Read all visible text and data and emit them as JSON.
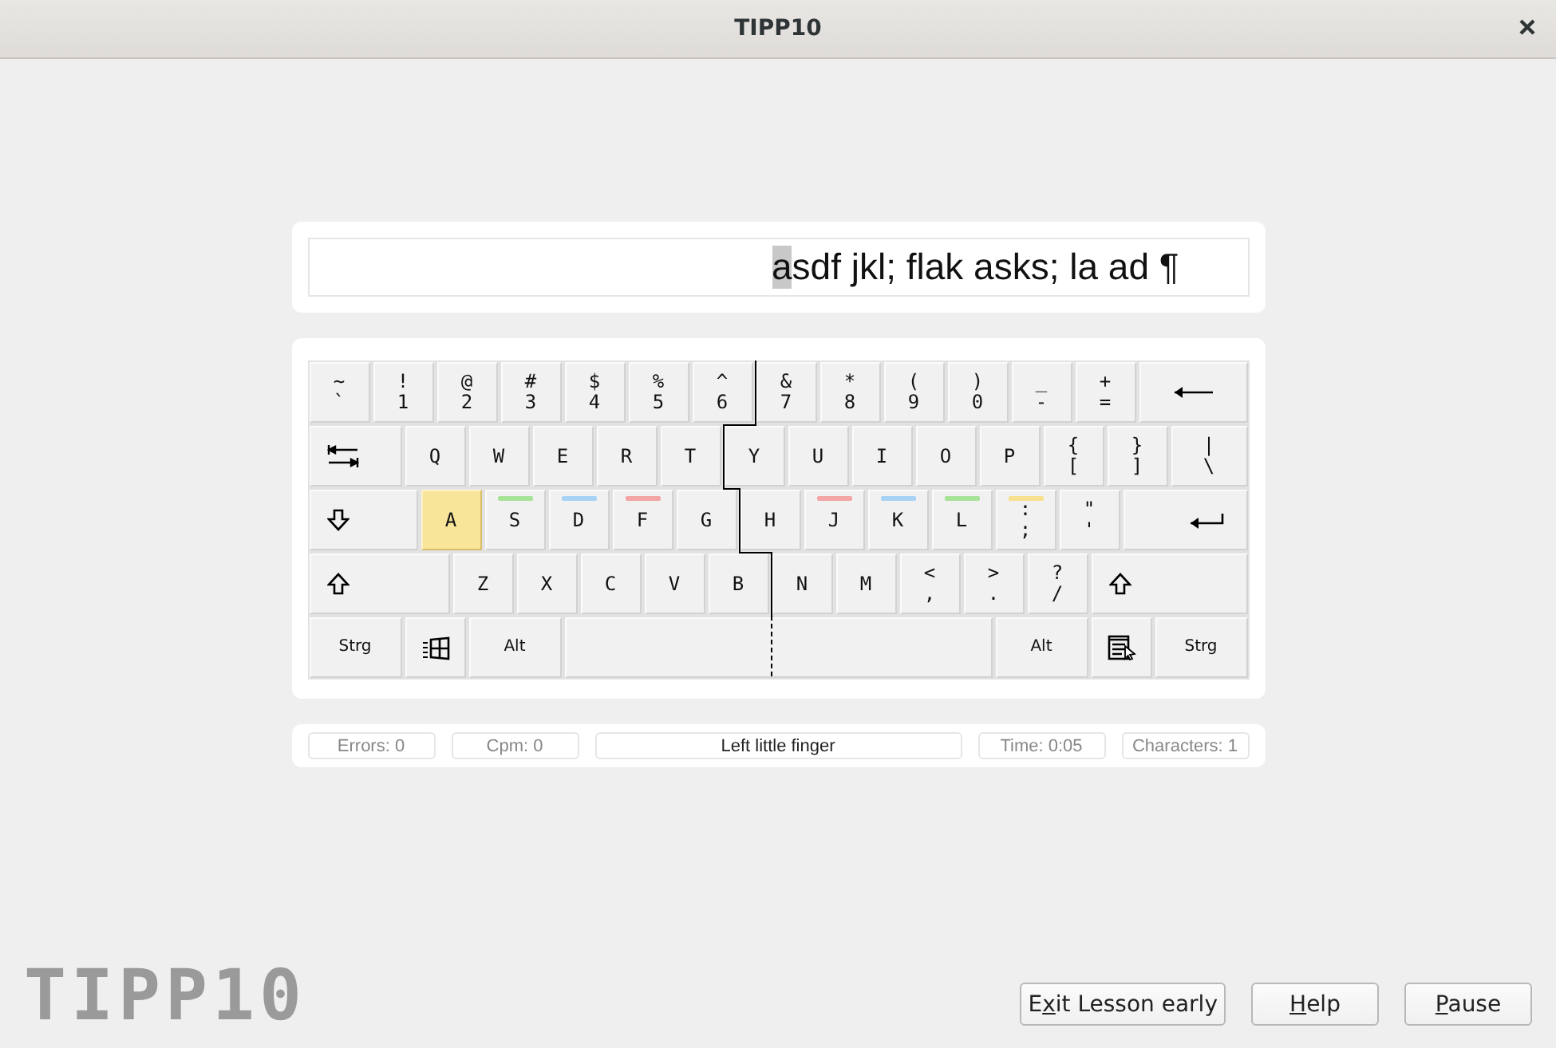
{
  "window": {
    "title": "TIPP10"
  },
  "text_line": {
    "current": "a",
    "remaining": "sdf jkl; flak asks; la ad ¶"
  },
  "keyboard": {
    "rows": [
      {
        "keys": [
          {
            "kind": "dual",
            "shift": "~",
            "label": "`",
            "highlighted": false
          },
          {
            "kind": "dual",
            "shift": "!",
            "label": "1",
            "highlighted": false
          },
          {
            "kind": "dual",
            "shift": "@",
            "label": "2",
            "highlighted": false
          },
          {
            "kind": "dual",
            "shift": "#",
            "label": "3",
            "highlighted": false
          },
          {
            "kind": "dual",
            "shift": "$",
            "label": "4",
            "highlighted": false
          },
          {
            "kind": "dual",
            "shift": "%",
            "label": "5",
            "highlighted": false
          },
          {
            "kind": "dual",
            "shift": "^",
            "label": "6",
            "highlighted": false
          },
          {
            "kind": "dual",
            "shift": "&",
            "label": "7",
            "highlighted": false
          },
          {
            "kind": "dual",
            "shift": "*",
            "label": "8",
            "highlighted": false
          },
          {
            "kind": "dual",
            "shift": "(",
            "label": "9",
            "highlighted": false
          },
          {
            "kind": "dual",
            "shift": ")",
            "label": "0",
            "highlighted": false
          },
          {
            "kind": "dual",
            "shift": "_",
            "label": "-",
            "highlighted": false
          },
          {
            "kind": "dual",
            "shift": "+",
            "label": "=",
            "highlighted": false
          },
          {
            "kind": "backspace",
            "highlighted": false
          }
        ]
      },
      {
        "keys": [
          {
            "kind": "tab",
            "highlighted": false
          },
          {
            "kind": "letter",
            "label": "Q",
            "highlighted": false
          },
          {
            "kind": "letter",
            "label": "W",
            "highlighted": false
          },
          {
            "kind": "letter",
            "label": "E",
            "highlighted": false
          },
          {
            "kind": "letter",
            "label": "R",
            "highlighted": false
          },
          {
            "kind": "letter",
            "label": "T",
            "highlighted": false
          },
          {
            "kind": "letter",
            "label": "Y",
            "highlighted": false
          },
          {
            "kind": "letter",
            "label": "U",
            "highlighted": false
          },
          {
            "kind": "letter",
            "label": "I",
            "highlighted": false
          },
          {
            "kind": "letter",
            "label": "O",
            "highlighted": false
          },
          {
            "kind": "letter",
            "label": "P",
            "highlighted": false
          },
          {
            "kind": "dual",
            "shift": "{",
            "label": "[",
            "highlighted": false
          },
          {
            "kind": "dual",
            "shift": "}",
            "label": "]",
            "highlighted": false
          },
          {
            "kind": "dual",
            "shift": "|",
            "label": "\\",
            "highlighted": false
          }
        ]
      },
      {
        "keys": [
          {
            "kind": "caps",
            "highlighted": false
          },
          {
            "kind": "letter",
            "label": "A",
            "highlighted": true
          },
          {
            "kind": "letter",
            "label": "S",
            "highlighted": false,
            "color": "#a8e39a"
          },
          {
            "kind": "letter",
            "label": "D",
            "highlighted": false,
            "color": "#a9d3f5"
          },
          {
            "kind": "letter",
            "label": "F",
            "highlighted": false,
            "color": "#f4a5a5"
          },
          {
            "kind": "letter",
            "label": "G",
            "highlighted": false
          },
          {
            "kind": "letter",
            "label": "H",
            "highlighted": false
          },
          {
            "kind": "letter",
            "label": "J",
            "highlighted": false,
            "color": "#f4a5a5"
          },
          {
            "kind": "letter",
            "label": "K",
            "highlighted": false,
            "color": "#a9d3f5"
          },
          {
            "kind": "letter",
            "label": "L",
            "highlighted": false,
            "color": "#a8e39a"
          },
          {
            "kind": "dual",
            "shift": ":",
            "label": ";",
            "highlighted": false,
            "color": "#f7e08e"
          },
          {
            "kind": "dual",
            "shift": "\"",
            "label": "'",
            "highlighted": false
          },
          {
            "kind": "enter",
            "highlighted": false
          }
        ]
      },
      {
        "keys": [
          {
            "kind": "shift",
            "highlighted": false
          },
          {
            "kind": "letter",
            "label": "Z",
            "highlighted": false
          },
          {
            "kind": "letter",
            "label": "X",
            "highlighted": false
          },
          {
            "kind": "letter",
            "label": "C",
            "highlighted": false
          },
          {
            "kind": "letter",
            "label": "V",
            "highlighted": false
          },
          {
            "kind": "letter",
            "label": "B",
            "highlighted": false
          },
          {
            "kind": "letter",
            "label": "N",
            "highlighted": false
          },
          {
            "kind": "letter",
            "label": "M",
            "highlighted": false
          },
          {
            "kind": "dual",
            "shift": "<",
            "label": ",",
            "highlighted": false
          },
          {
            "kind": "dual",
            "shift": ">",
            "label": ".",
            "highlighted": false
          },
          {
            "kind": "dual",
            "shift": "?",
            "label": "/",
            "highlighted": false
          },
          {
            "kind": "shift",
            "highlighted": false
          }
        ]
      },
      {
        "keys": [
          {
            "kind": "modifier",
            "label": "Strg",
            "highlighted": false
          },
          {
            "kind": "windows",
            "highlighted": false
          },
          {
            "kind": "modifier",
            "label": "Alt",
            "highlighted": false
          },
          {
            "kind": "space",
            "highlighted": false
          },
          {
            "kind": "modifier",
            "label": "Alt",
            "highlighted": false
          },
          {
            "kind": "menu",
            "highlighted": false
          },
          {
            "kind": "modifier",
            "label": "Strg",
            "highlighted": false
          }
        ]
      }
    ]
  },
  "status_bar": [
    {
      "kind": "stat",
      "text": "Errors: 0"
    },
    {
      "kind": "stat",
      "text": "Cpm: 0"
    },
    {
      "kind": "hint",
      "text": "Left little finger"
    },
    {
      "kind": "stat",
      "text": "Time: 0:05"
    },
    {
      "kind": "stat",
      "text": "Characters: 1"
    }
  ],
  "logo": "TIPP10",
  "buttons": [
    {
      "before": "E",
      "mnemonic": "x",
      "after": "it Lesson early"
    },
    {
      "mnemonic": "H",
      "after": "elp"
    },
    {
      "mnemonic": "P",
      "after": "ause"
    }
  ]
}
